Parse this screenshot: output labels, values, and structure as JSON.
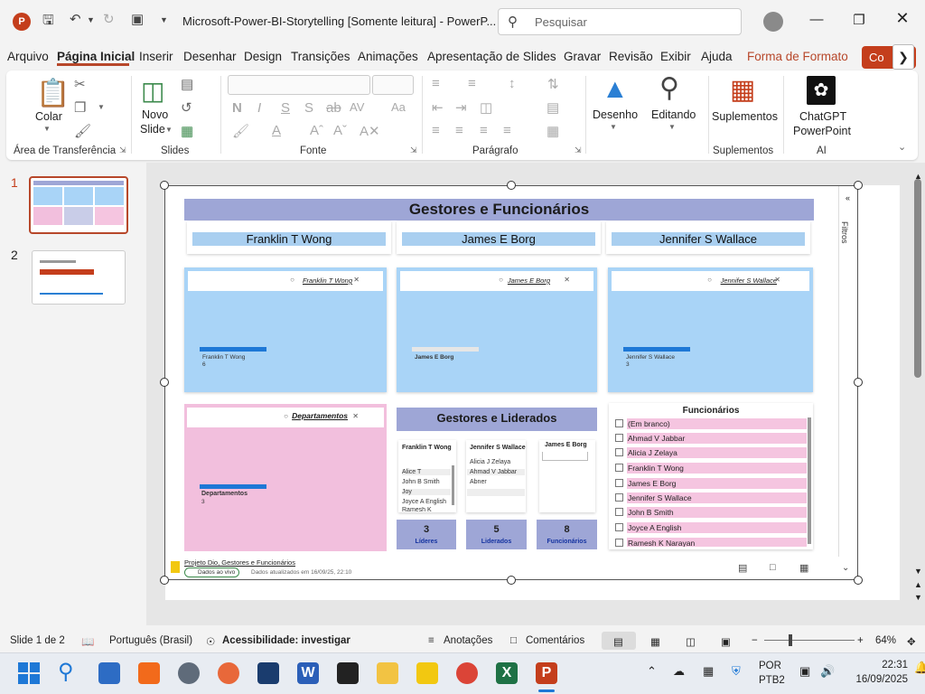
{
  "titlebar": {
    "app_icon": "P",
    "document_title": "Microsoft-Power-BI-Storytelling [Somente leitura]  -  PowerP...",
    "search_placeholder": "Pesquisar"
  },
  "tabs": [
    {
      "label": "Arquivo"
    },
    {
      "label": "Página Inicial",
      "active": true
    },
    {
      "label": "Inserir"
    },
    {
      "label": "Desenhar"
    },
    {
      "label": "Design"
    },
    {
      "label": "Transições"
    },
    {
      "label": "Animações"
    },
    {
      "label": "Apresentação de Slides"
    },
    {
      "label": "Gravar"
    },
    {
      "label": "Revisão"
    },
    {
      "label": "Exibir"
    },
    {
      "label": "Ajuda"
    },
    {
      "label": "Forma de Formato"
    }
  ],
  "co_button": "Co",
  "ribbon": {
    "clipboard": {
      "paste_label": "Colar",
      "group_label": "Área de Transferência"
    },
    "slides": {
      "new_slide_line1": "Novo",
      "new_slide_line2": "Slide",
      "group_label": "Slides"
    },
    "font": {
      "group_label": "Fonte"
    },
    "paragraph": {
      "group_label": "Parágrafo"
    },
    "drawing": {
      "label": "Desenho"
    },
    "editing": {
      "label": "Editando"
    },
    "addins": {
      "button_label": "Suplementos",
      "group_label": "Suplementos"
    },
    "ai": {
      "button_line1": "ChatGPT",
      "button_line2": "PowerPoint",
      "group_label": "AI"
    }
  },
  "thumbnails": [
    {
      "number": "1",
      "selected": true
    },
    {
      "number": "2",
      "selected": false
    }
  ],
  "slide": {
    "report_title": "Gestores e Funcionários",
    "managers": [
      "Franklin T Wong",
      "James E Borg",
      "Jennifer S Wallace"
    ],
    "manager_cards": [
      {
        "filter_label": "Franklin T Wong",
        "bar_name": "Franklin T Wong",
        "bar_value": "6"
      },
      {
        "filter_label": "James E Borg",
        "bar_name": "James E Borg",
        "bar_value": ""
      },
      {
        "filter_label": "Jennifer S Wallace",
        "bar_name": "Jennifer S Wallace",
        "bar_value": "3"
      }
    ],
    "dept_card": {
      "filter_label": "Departamentos",
      "bar_name": "Departamentos",
      "bar_value": "3"
    },
    "gl_title": "Gestores e Liderados",
    "mini_tables": [
      {
        "header": "Franklin T Wong",
        "rows": [
          "Alice T",
          "John B Smith",
          "Joy",
          "Joyce A English",
          "Ramesh K"
        ]
      },
      {
        "header": "Jennifer S Wallace",
        "rows": [
          "Alicia J Zelaya",
          "Ahmad V Jabbar",
          "Abner"
        ]
      },
      {
        "header": "James E Borg",
        "rows": []
      }
    ],
    "kpis": [
      {
        "value": "3",
        "label": "Líderes"
      },
      {
        "value": "5",
        "label": "Liderados"
      },
      {
        "value": "8",
        "label": "Funcionários"
      }
    ],
    "funcionarios_title": "Funcionários",
    "funcionarios": [
      "(Em branco)",
      "Ahmad V Jabbar",
      "Alicia J Zelaya",
      "Franklin T Wong",
      "James E Borg",
      "Jennifer S Wallace",
      "John B Smith",
      "Joyce A English",
      "Ramesh K Narayan"
    ],
    "filters_label": "Filtros",
    "footer_link": "Projeto Dio, Gestores e Funcionários",
    "footer_live": "Dados ao vivo",
    "footer_updated": "Dados atualizados em 16/09/25, 22:10"
  },
  "statusbar": {
    "slide_info": "Slide 1 de 2",
    "language": "Português (Brasil)",
    "accessibility": "Acessibilidade: investigar",
    "notes": "Anotações",
    "comments": "Comentários",
    "zoom": "64%"
  },
  "taskbar": {
    "lang_line1": "POR",
    "lang_line2": "PTB2",
    "time": "22:31",
    "date": "16/09/2025"
  },
  "colors": {
    "accent": "#c43e1c",
    "report_header": "#9ea6d6",
    "card_blue": "#a9d4f7",
    "card_pink": "#f2bfdd",
    "bar_blue": "#1e78d6"
  }
}
